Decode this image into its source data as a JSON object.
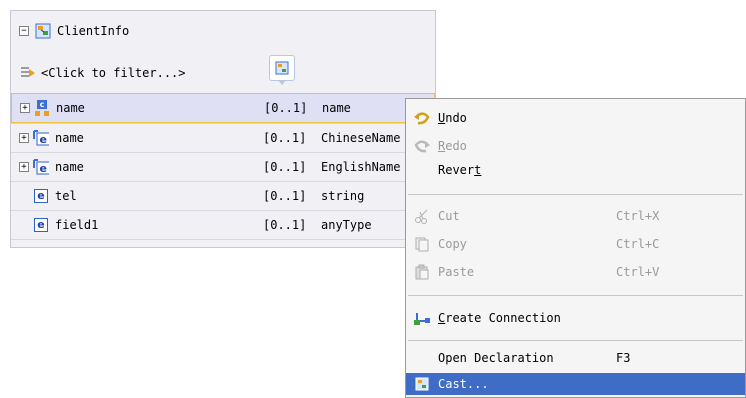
{
  "schema": {
    "title": "ClientInfo",
    "filter_text": "<Click to filter...>",
    "rows": [
      {
        "name": "name",
        "cardinality": "[0..1]",
        "type": "name",
        "expandable": true,
        "icon": "complex-element-icon",
        "selected": true
      },
      {
        "name": "name",
        "cardinality": "[0..1]",
        "type": "ChineseName",
        "expandable": true,
        "icon": "element-icon",
        "selected": false
      },
      {
        "name": "name",
        "cardinality": "[0..1]",
        "type": "EnglishName",
        "expandable": true,
        "icon": "element-icon",
        "selected": false
      },
      {
        "name": "tel",
        "cardinality": "[0..1]",
        "type": "string",
        "expandable": false,
        "icon": "element-icon",
        "selected": false
      },
      {
        "name": "field1",
        "cardinality": "[0..1]",
        "type": "anyType",
        "expandable": false,
        "icon": "element-icon",
        "selected": false
      }
    ]
  },
  "menu": {
    "undo": {
      "label": "Undo",
      "mnemonic": "U",
      "rest": "ndo"
    },
    "redo": {
      "label": "Redo",
      "mnemonic": "R",
      "rest": "edo"
    },
    "revert": {
      "label": "Revert",
      "pre": "Rever",
      "mnemonic": "t"
    },
    "cut": {
      "label": "Cut",
      "shortcut": "Ctrl+X"
    },
    "copy": {
      "label": "Copy",
      "shortcut": "Ctrl+C"
    },
    "paste": {
      "label": "Paste",
      "shortcut": "Ctrl+V"
    },
    "create_connection": {
      "label": "Create Connection",
      "mnemonic": "C",
      "rest": "reate Connection"
    },
    "open_declaration": {
      "label": "Open Declaration",
      "shortcut": "F3"
    },
    "cast": {
      "label": "Cast..."
    }
  },
  "colors": {
    "highlight": "#3f6cc4",
    "panel_bg": "#f0f0f5",
    "selected_row_bg": "#e0e0f5"
  }
}
